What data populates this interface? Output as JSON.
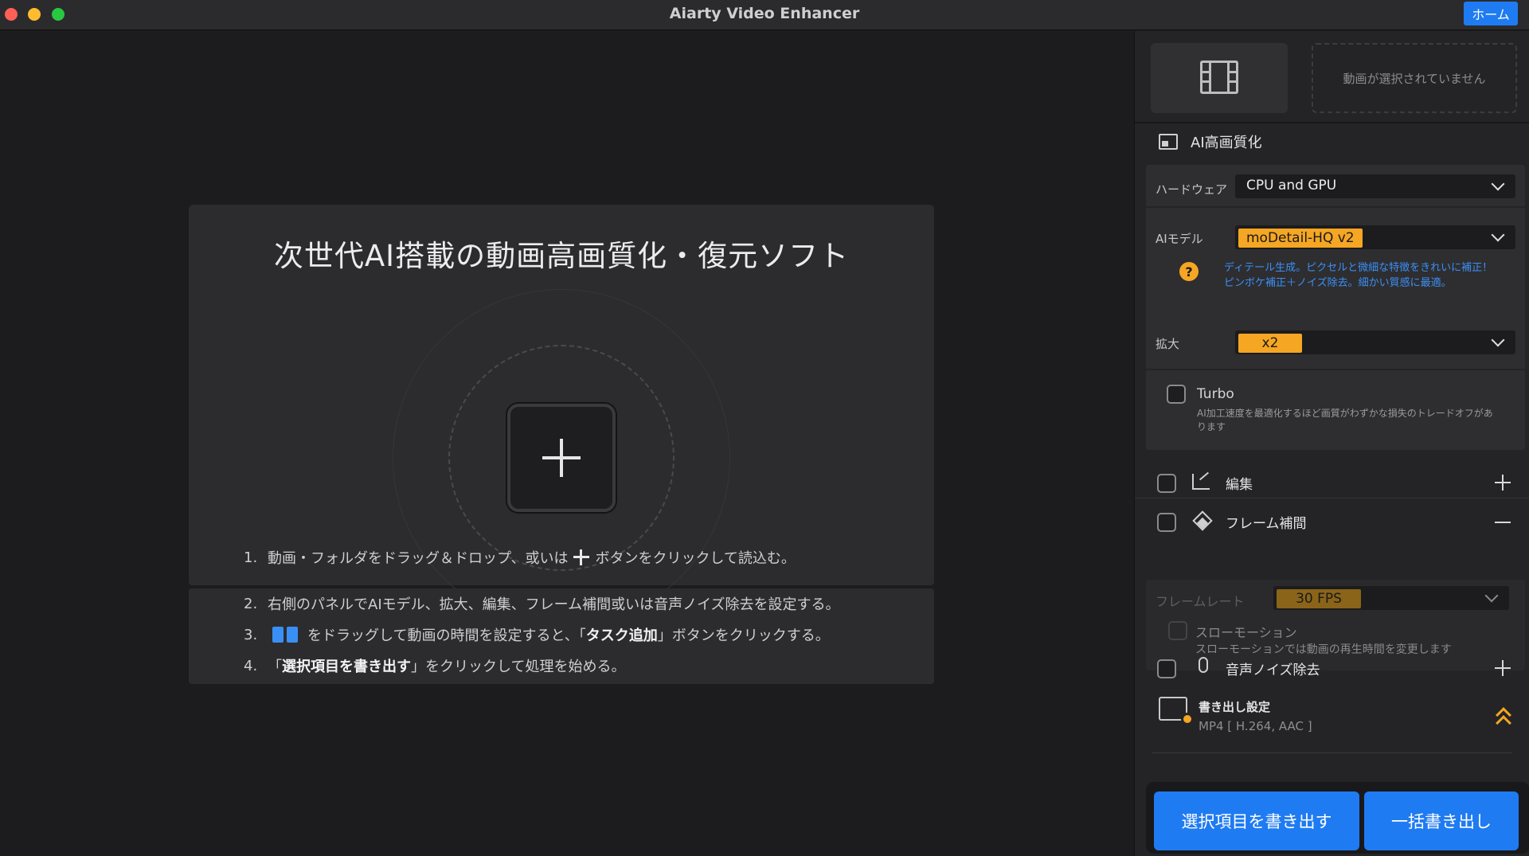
{
  "window": {
    "title": "Aiarty Video Enhancer",
    "home_label": "ホーム"
  },
  "main": {
    "headline": "次世代AI搭載の動画高画質化・復元ソフト",
    "steps": [
      {
        "num": "1.",
        "text_a": "動画・フォルダをドラッグ＆ドロップ、或いは",
        "text_b": "ボタンをクリックして読込む。"
      },
      {
        "num": "2.",
        "text": "右側のパネルでAIモデル、拡大、編集、フレーム補間或いは音声ノイズ除去を設定する。"
      },
      {
        "num": "3.",
        "text_a": "をドラッグして動画の時間を設定すると、「",
        "bold": "タスク追加",
        "text_b": "」ボタンをクリックする。"
      },
      {
        "num": "4.",
        "text_a": "「",
        "bold": "選択項目を書き出す",
        "text_b": "」をクリックして処理を始める。"
      }
    ]
  },
  "panel": {
    "no_video": "動画が選択されていません",
    "enhance": {
      "title": "AI高画質化",
      "hardware_label": "ハードウェア",
      "hardware_value": "CPU and GPU",
      "model_label": "AIモデル",
      "model_value": "moDetail-HQ  v2",
      "help_glyph": "?",
      "model_desc_1": "ディテール生成。ピクセルと微細な特徴をきれいに補正！",
      "model_desc_2": "ピンボケ補正＋ノイズ除去。細かい質感に最適。",
      "scale_label": "拡大",
      "scale_value": "x2",
      "turbo_label": "Turbo",
      "turbo_desc_1": "AI加工速度を最適化するほど画質がわずかな損失のトレードオフがあ",
      "turbo_desc_2": "ります"
    },
    "edit_label": "編集",
    "frame": {
      "label": "フレーム補間",
      "rate_label": "フレームレート",
      "rate_value": "30 FPS",
      "slow_label": "スローモーション",
      "slow_desc": "スローモーションでは動画の再生時間を変更します"
    },
    "audio_label": "音声ノイズ除去",
    "export": {
      "title": "書き出し設定",
      "format": "MP4 [ H.264, AAC ]"
    },
    "btn_export_selected": "選択項目を書き出す",
    "btn_export_all": "一括書き出し"
  },
  "colors": {
    "accent_blue": "#1f7bf2",
    "accent_orange": "#f5a623"
  }
}
